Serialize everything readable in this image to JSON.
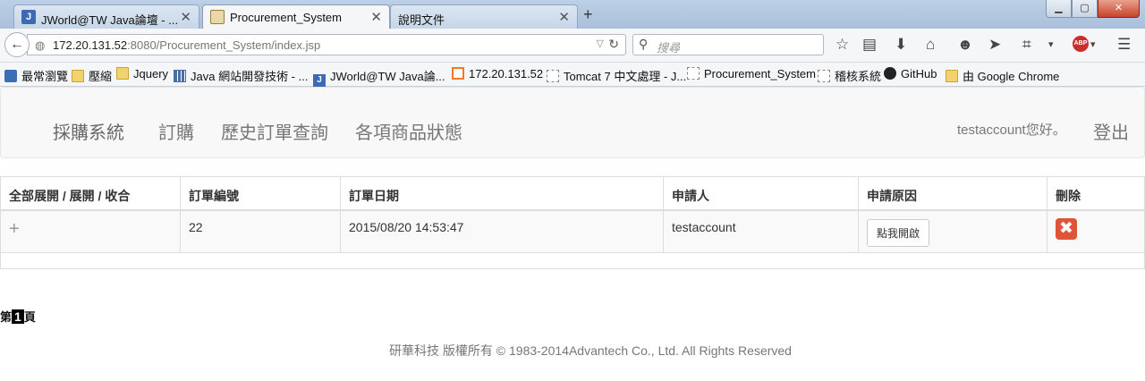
{
  "browser": {
    "tabs": [
      {
        "title": "JWorld@TW Java論壇 - ...",
        "icon": "jworld-favicon"
      },
      {
        "title": "Procurement_System",
        "icon": "image-favicon"
      },
      {
        "title": "說明文件",
        "icon": "none"
      }
    ],
    "url_host": "172.20.131.52",
    "url_rest": ":8080/Procurement_System/index.jsp",
    "search_placeholder": "搜尋",
    "abp_label": "ABP",
    "bookmarks": [
      {
        "label": "最常瀏覽",
        "icon": "star-icon"
      },
      {
        "label": "壓縮",
        "icon": "folder-icon"
      },
      {
        "label": "Jquery",
        "icon": "folder-icon"
      },
      {
        "label": "Java 網站開發技術 - ...",
        "icon": "grid-icon"
      },
      {
        "label": "JWorld@TW Java論...",
        "icon": "jworld-icon"
      },
      {
        "label": "172.20.131.52",
        "icon": "xampp-icon"
      },
      {
        "label": "Tomcat 7 中文處理 - J...",
        "icon": "page-icon"
      },
      {
        "label": "Procurement_System",
        "icon": "page-icon"
      },
      {
        "label": "稽核系統",
        "icon": "page-icon"
      },
      {
        "label": "GitHub",
        "icon": "github-icon"
      },
      {
        "label": "由 Google Chrome",
        "icon": "folder-icon"
      }
    ]
  },
  "site": {
    "brand": "採購系統",
    "nav": [
      "訂購",
      "歷史訂單查詢",
      "各項商品狀態"
    ],
    "greeting": "testaccount您好。",
    "logout": "登出"
  },
  "table": {
    "headers": [
      "全部展開 / 展開 / 收合",
      "訂單編號",
      "訂單日期",
      "申請人",
      "申請原因",
      "刪除"
    ],
    "rows": [
      {
        "expand": "+",
        "order_id": "22",
        "date": "2015/08/20 14:53:47",
        "applicant": "testaccount",
        "reason_button": "點我開啟",
        "delete": "✖"
      }
    ]
  },
  "pager": {
    "prefix": "第",
    "page": "1",
    "suffix": "頁"
  },
  "footer": "研華科技 版權所有 © 1983-2014Advantech Co., Ltd. All Rights Reserved",
  "colors": {
    "delete": "#e0553a",
    "navbar_bg": "#f8f8f8",
    "link": "#777777"
  }
}
